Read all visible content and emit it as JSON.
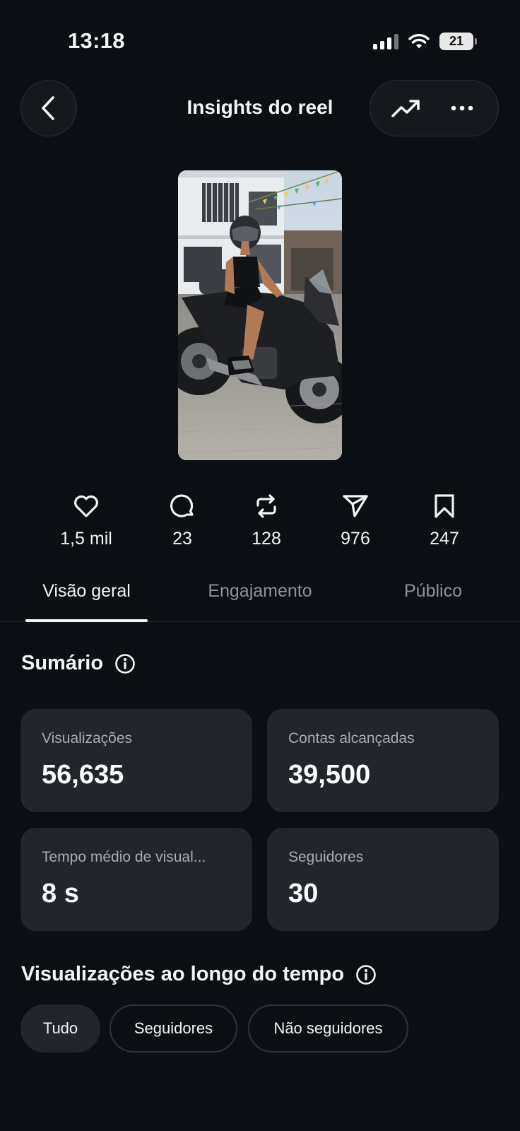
{
  "status_bar": {
    "time": "13:18",
    "battery": "21"
  },
  "header": {
    "title": "Insights do reel"
  },
  "stats": [
    {
      "icon": "heart-icon",
      "value": "1,5 mil"
    },
    {
      "icon": "comment-icon",
      "value": "23"
    },
    {
      "icon": "repost-icon",
      "value": "128"
    },
    {
      "icon": "share-icon",
      "value": "976"
    },
    {
      "icon": "bookmark-icon",
      "value": "247"
    }
  ],
  "tabs": [
    {
      "label": "Visão geral",
      "active": true
    },
    {
      "label": "Engajamento",
      "active": false
    },
    {
      "label": "Público",
      "active": false
    }
  ],
  "summary": {
    "title": "Sumário",
    "cards": [
      {
        "label": "Visualizações",
        "value": "56,635"
      },
      {
        "label": "Contas alcançadas",
        "value": "39,500"
      },
      {
        "label": "Tempo médio de visual...",
        "value": "8 s"
      },
      {
        "label": "Seguidores",
        "value": "30"
      }
    ]
  },
  "views_over_time": {
    "title": "Visualizações ao longo do tempo",
    "filters": [
      {
        "label": "Tudo",
        "selected": true
      },
      {
        "label": "Seguidores",
        "selected": false
      },
      {
        "label": "Não seguidores",
        "selected": false
      }
    ]
  },
  "colors": {
    "background": "#0b0f14",
    "card": "#22262c",
    "text": "#f2f4f7",
    "muted": "#8d939b"
  }
}
